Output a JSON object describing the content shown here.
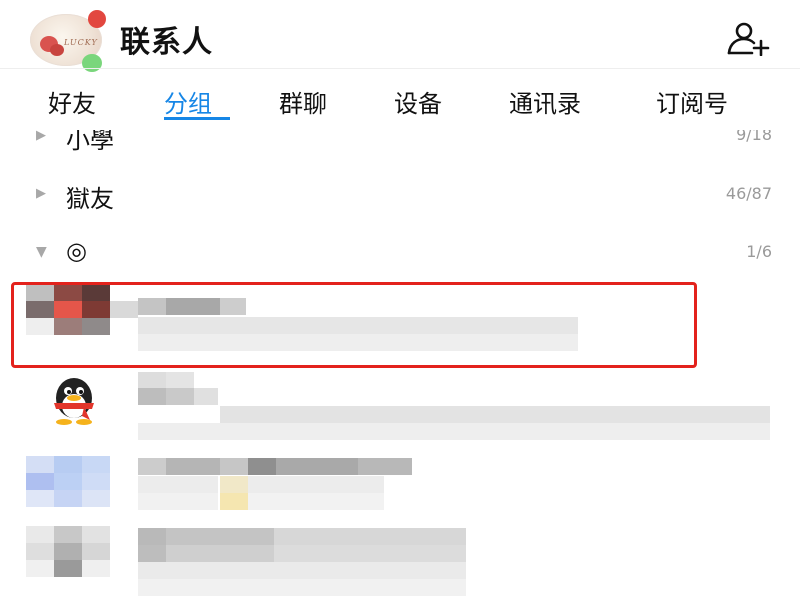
{
  "header": {
    "title": "联系人",
    "avatar_icon": "user-avatar",
    "add_contact_icon": "add-contact-icon"
  },
  "tabs": [
    {
      "label": "好友",
      "active": false
    },
    {
      "label": "分组",
      "active": true
    },
    {
      "label": "群聊",
      "active": false
    },
    {
      "label": "设备",
      "active": false
    },
    {
      "label": "通讯录",
      "active": false
    },
    {
      "label": "订阅号",
      "active": false
    }
  ],
  "groups": [
    {
      "name": "小學",
      "count": "9/18",
      "expanded": false
    },
    {
      "name": "獄友",
      "count": "46/87",
      "expanded": false
    },
    {
      "name": "◎",
      "count": "1/6",
      "expanded": true
    }
  ],
  "colors": {
    "accent": "#1686e6",
    "highlight_border": "#e3221c",
    "text": "#111111",
    "muted": "#9a9a9a"
  }
}
